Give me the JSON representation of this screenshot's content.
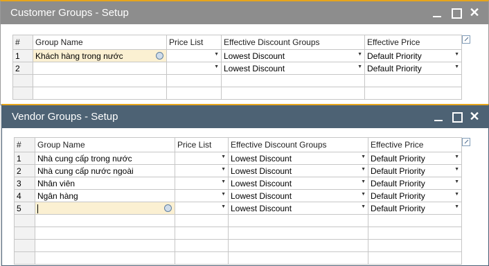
{
  "customer": {
    "title": "Customer Groups - Setup",
    "columns": [
      "#",
      "Group Name",
      "Price List",
      "Effective Discount Groups",
      "Effective Price"
    ],
    "rows": [
      {
        "no": "1",
        "name": "Khách hàng trong nước",
        "price_list": "",
        "discount": "Lowest Discount",
        "price": "Default Priority"
      },
      {
        "no": "2",
        "name": "",
        "price_list": "",
        "discount": "Lowest Discount",
        "price": "Default Priority"
      }
    ]
  },
  "vendor": {
    "title": "Vendor Groups - Setup",
    "columns": [
      "#",
      "Group Name",
      "Price List",
      "Effective Discount Groups",
      "Effective Price"
    ],
    "rows": [
      {
        "no": "1",
        "name": "Nhà cung cấp trong nước",
        "price_list": "",
        "discount": "Lowest Discount",
        "price": "Default Priority"
      },
      {
        "no": "2",
        "name": "Nhà cung cấp nước ngoài",
        "price_list": "",
        "discount": "Lowest Discount",
        "price": "Default Priority"
      },
      {
        "no": "3",
        "name": "Nhân viên",
        "price_list": "",
        "discount": "Lowest Discount",
        "price": "Default Priority"
      },
      {
        "no": "4",
        "name": "Ngân hàng",
        "price_list": "",
        "discount": "Lowest Discount",
        "price": "Default Priority"
      },
      {
        "no": "5",
        "name": "",
        "price_list": "",
        "discount": "Lowest Discount",
        "price": "Default Priority"
      }
    ]
  },
  "colors": {
    "accent": "#e6a51c",
    "inactive_titlebar": "#8d8d8d",
    "active_titlebar": "#4d6274",
    "active_cell": "#fbf0d2"
  }
}
